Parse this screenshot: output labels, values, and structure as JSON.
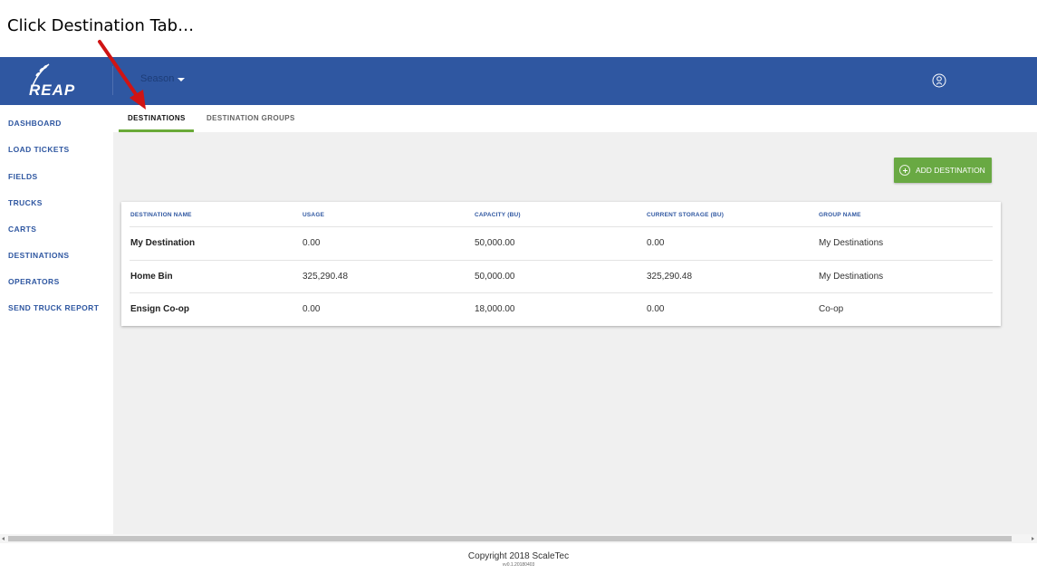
{
  "caption": "Click Destination Tab…",
  "colors": {
    "header": "#2f57a1",
    "accent_green": "#69a943",
    "nav_text": "#2f57a1",
    "arrow": "#d01414"
  },
  "header": {
    "logo_text": "REAP",
    "season_label": "Season",
    "user_icon": "user-circle-icon"
  },
  "sidebar": {
    "items": [
      {
        "label": "DASHBOARD"
      },
      {
        "label": "LOAD TICKETS"
      },
      {
        "label": "FIELDS"
      },
      {
        "label": "TRUCKS"
      },
      {
        "label": "CARTS"
      },
      {
        "label": "DESTINATIONS"
      },
      {
        "label": "OPERATORS"
      },
      {
        "label": "SEND TRUCK REPORT"
      }
    ]
  },
  "tabs": [
    {
      "label": "DESTINATIONS",
      "active": true
    },
    {
      "label": "DESTINATION GROUPS",
      "active": false
    }
  ],
  "actions": {
    "add_destination_label": "ADD DESTINATION",
    "add_icon": "plus-circle-icon"
  },
  "table": {
    "headers": [
      "DESTINATION NAME",
      "USAGE",
      "CAPACITY (BU)",
      "CURRENT STORAGE (BU)",
      "GROUP NAME"
    ],
    "rows": [
      [
        "My Destination",
        "0.00",
        "50,000.00",
        "0.00",
        "My Destinations"
      ],
      [
        "Home Bin",
        "325,290.48",
        "50,000.00",
        "325,290.48",
        "My Destinations"
      ],
      [
        "Ensign Co-op",
        "0.00",
        "18,000.00",
        "0.00",
        "Co-op"
      ]
    ]
  },
  "footer": {
    "copyright": "Copyright 2018 ScaleTec",
    "version": "vv0.1.20180403"
  }
}
